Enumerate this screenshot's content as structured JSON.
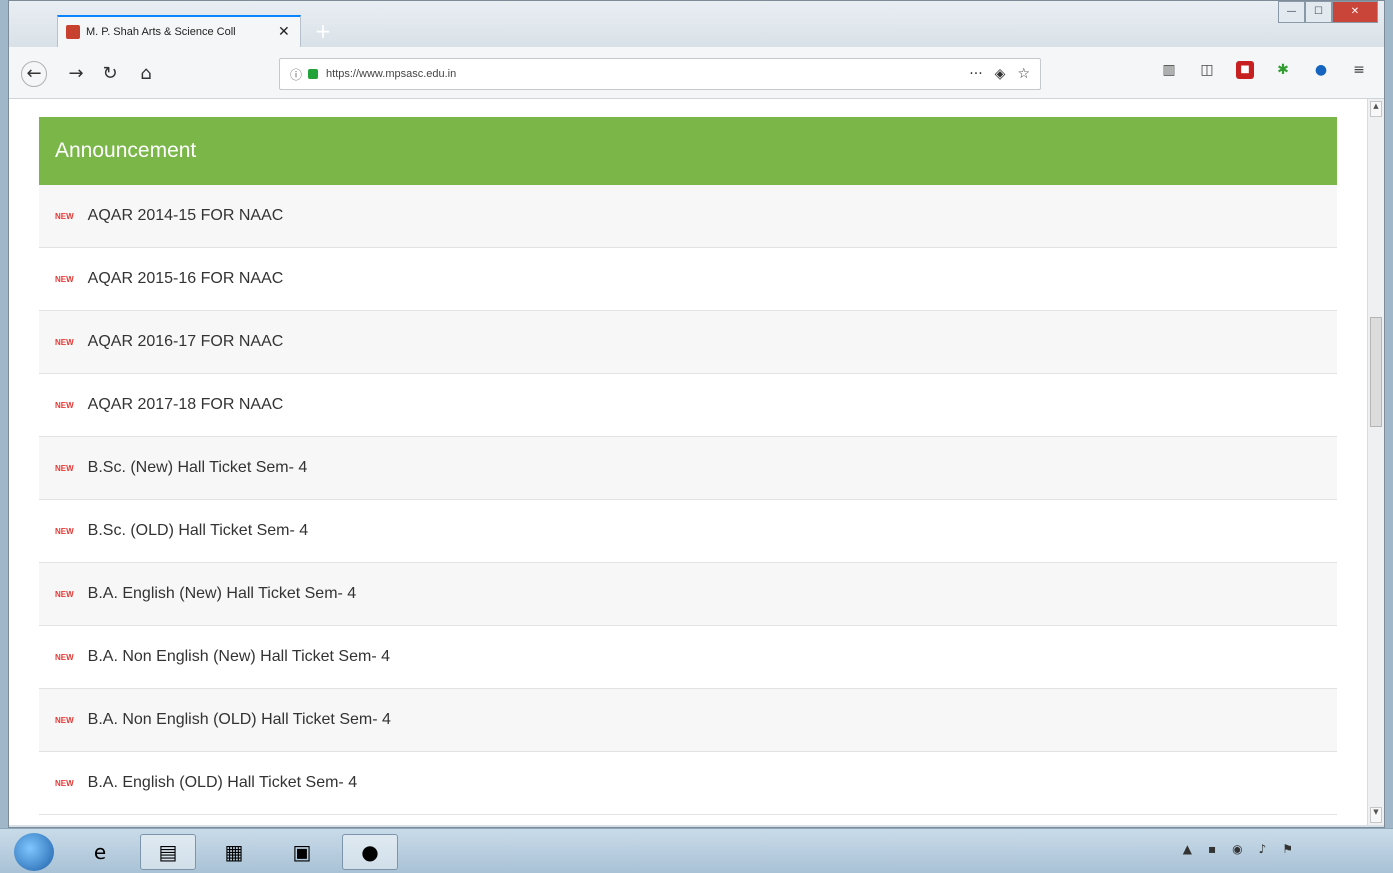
{
  "browser": {
    "tab_title": "M. P. Shah Arts & Science Coll",
    "tab_close": "✕",
    "new_tab": "+",
    "url": "https://www.mpsasc.edu.in",
    "url_more": "···",
    "window_min": "—",
    "window_max": "☐",
    "window_close": "✕"
  },
  "panel": {
    "heading": "Announcement",
    "new_badge": "NEW",
    "items": [
      "AQAR 2014-15 FOR NAAC",
      "AQAR 2015-16 FOR NAAC",
      "AQAR 2016-17 FOR NAAC",
      "AQAR 2017-18 FOR NAAC",
      "B.Sc. (New) Hall Ticket Sem- 4",
      "B.Sc. (OLD) Hall Ticket Sem- 4",
      "B.A. English (New) Hall Ticket Sem- 4",
      "B.A. Non English (New) Hall Ticket Sem- 4",
      "B.A. Non English (OLD) Hall Ticket Sem- 4",
      "B.A. English (OLD) Hall Ticket Sem- 4"
    ]
  },
  "colors": {
    "heading_bg": "#7ab648",
    "tab_accent": "#0a84ff"
  }
}
